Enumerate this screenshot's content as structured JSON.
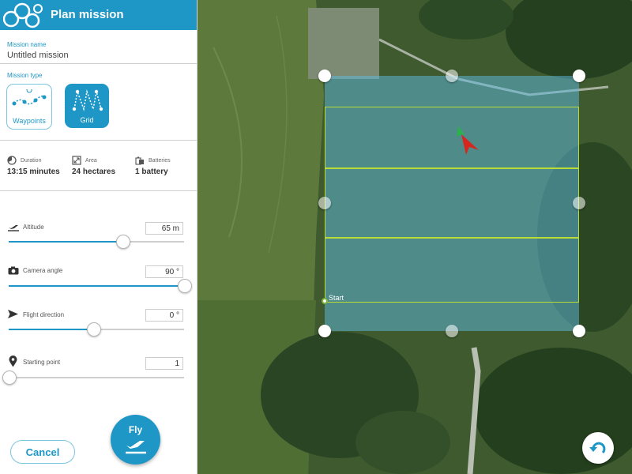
{
  "header": {
    "title": "Plan mission"
  },
  "mission_name": {
    "label": "Mission name",
    "value": "Untitled mission"
  },
  "mission_type": {
    "label": "Mission type",
    "options": [
      {
        "label": "Waypoints",
        "selected": false,
        "icon": "waypoints-path-icon"
      },
      {
        "label": "Grid",
        "selected": true,
        "icon": "grid-path-icon"
      }
    ]
  },
  "stats": {
    "duration": {
      "label": "Duration",
      "value": "13:15 minutes",
      "icon": "clock-icon"
    },
    "area": {
      "label": "Area",
      "value": "24 hectares",
      "icon": "area-icon"
    },
    "batteries": {
      "label": "Batteries",
      "value": "1 battery",
      "icon": "battery-icon"
    }
  },
  "settings": {
    "altitude": {
      "label": "Altitude",
      "value": "65 m",
      "slider_fraction": 0.65,
      "icon": "airplane-takeoff-icon"
    },
    "camera_angle": {
      "label": "Camera angle",
      "value": "90 °",
      "slider_fraction": 1.0,
      "icon": "camera-icon"
    },
    "flight_direction": {
      "label": "Flight direction",
      "value": "0 °",
      "slider_fraction": 0.48,
      "icon": "send-arrow-icon"
    },
    "starting_point": {
      "label": "Starting point",
      "value": "1",
      "slider_fraction": 0.0,
      "icon": "location-pin-icon"
    }
  },
  "actions": {
    "cancel_label": "Cancel",
    "fly_label": "Fly"
  },
  "map": {
    "start_label": "Start"
  },
  "colors": {
    "accent": "#1e97c7",
    "grid_line": "#b9dc37",
    "area_overlay": "#5eb9dc"
  }
}
